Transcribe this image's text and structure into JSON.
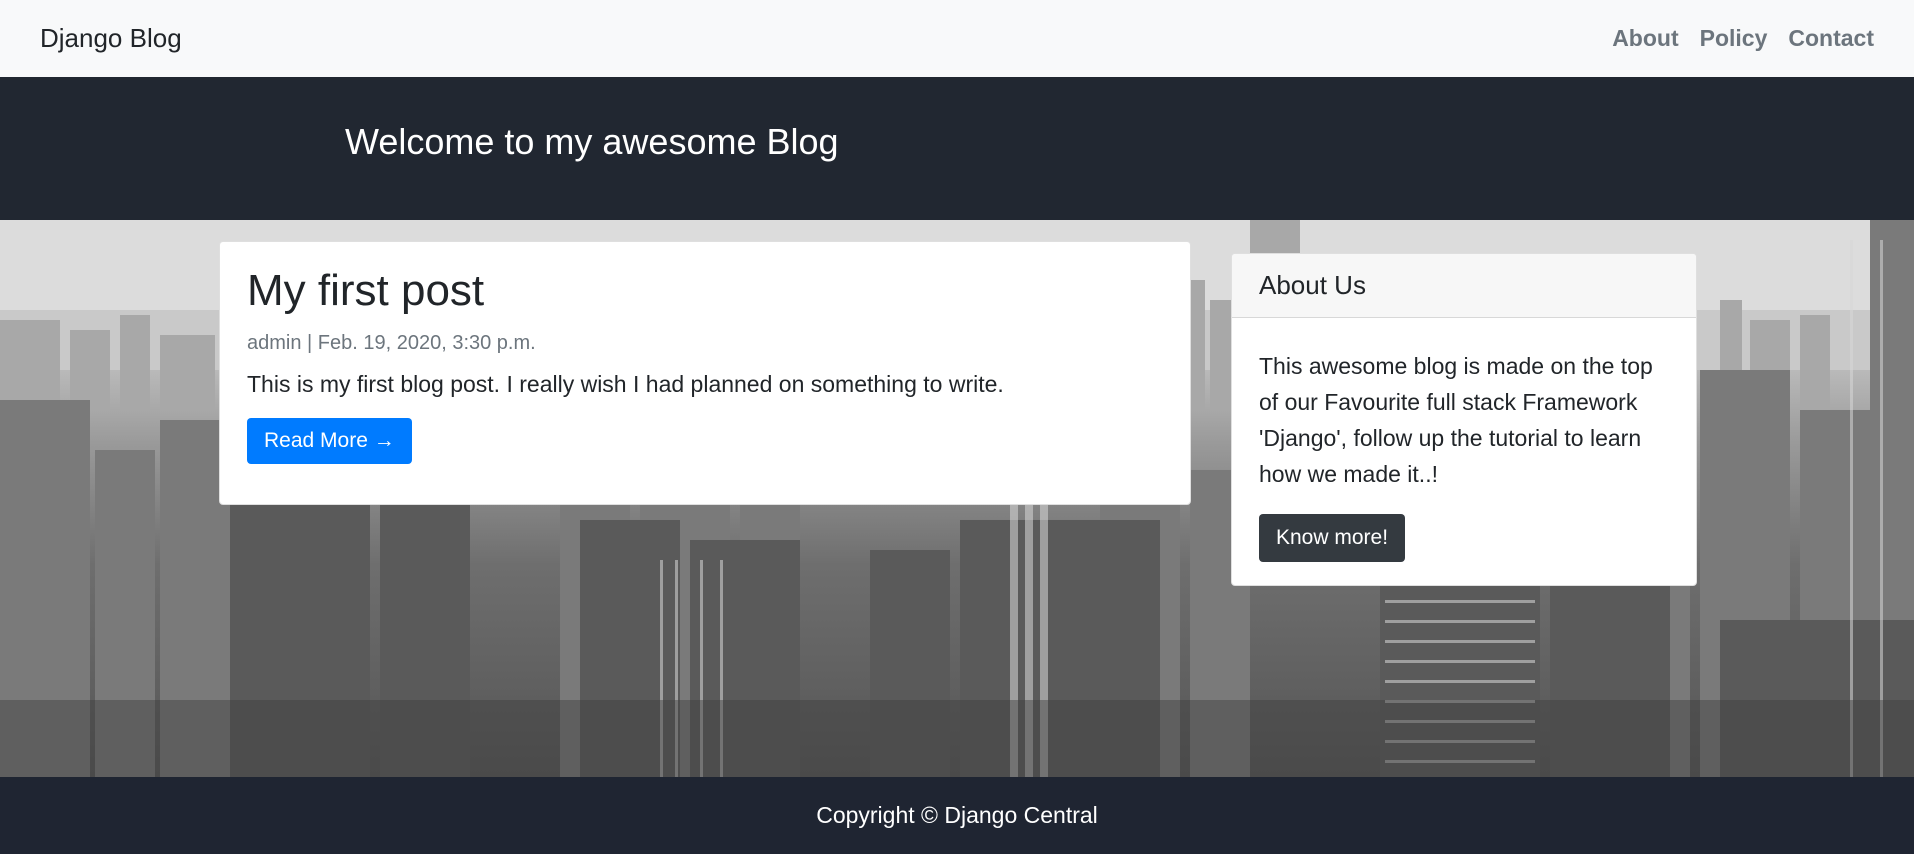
{
  "navbar": {
    "brand": "Django Blog",
    "links": [
      "About",
      "Policy",
      "Contact"
    ]
  },
  "masthead": {
    "title": "Welcome to my awesome Blog"
  },
  "post": {
    "title": "My first post",
    "meta": "admin | Feb. 19, 2020, 3:30 p.m.",
    "excerpt": "This is my first blog post. I really wish I had planned on something to write.",
    "read_more": "Read More →"
  },
  "about": {
    "header": "About Us",
    "text": "This awesome blog is made on the top of our Favourite full stack Framework 'Django', follow up the tutorial to learn how we made it..!",
    "button": "Know more!"
  },
  "footer": {
    "copyright": "Copyright © Django Central"
  },
  "colors": {
    "primary": "#007bff",
    "dark": "#343a40",
    "masthead": "#212731",
    "footer": "#1f2532"
  },
  "hero": {
    "image": "city-skyline-background"
  }
}
